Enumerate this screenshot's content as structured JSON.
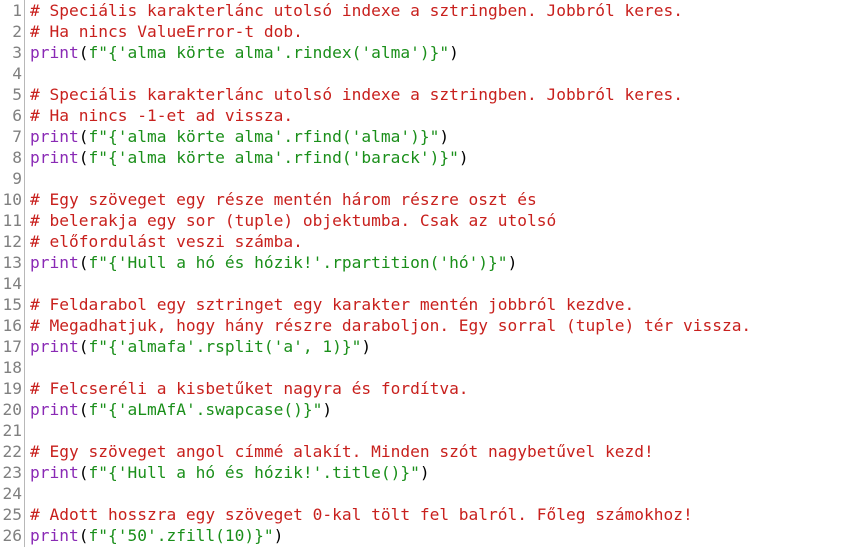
{
  "editor": {
    "lines": [
      {
        "n": "1",
        "tokens": [
          {
            "t": "comment",
            "v": "# Speciális karakterlánc utolsó indexe a sztringben. Jobbról keres."
          }
        ]
      },
      {
        "n": "2",
        "tokens": [
          {
            "t": "comment",
            "v": "# Ha nincs ValueError-t dob."
          }
        ]
      },
      {
        "n": "3",
        "tokens": [
          {
            "t": "builtin",
            "v": "print"
          },
          {
            "t": "plain",
            "v": "("
          },
          {
            "t": "string",
            "v": "f\"{'alma körte alma'.rindex('alma')}\""
          },
          {
            "t": "plain",
            "v": ")"
          }
        ]
      },
      {
        "n": "4",
        "tokens": []
      },
      {
        "n": "5",
        "tokens": [
          {
            "t": "comment",
            "v": "# Speciális karakterlánc utolsó indexe a sztringben. Jobbról keres."
          }
        ]
      },
      {
        "n": "6",
        "tokens": [
          {
            "t": "comment",
            "v": "# Ha nincs -1-et ad vissza."
          }
        ]
      },
      {
        "n": "7",
        "tokens": [
          {
            "t": "builtin",
            "v": "print"
          },
          {
            "t": "plain",
            "v": "("
          },
          {
            "t": "string",
            "v": "f\"{'alma körte alma'.rfind('alma')}\""
          },
          {
            "t": "plain",
            "v": ")"
          }
        ]
      },
      {
        "n": "8",
        "tokens": [
          {
            "t": "builtin",
            "v": "print"
          },
          {
            "t": "plain",
            "v": "("
          },
          {
            "t": "string",
            "v": "f\"{'alma körte alma'.rfind('barack')}\""
          },
          {
            "t": "plain",
            "v": ")"
          }
        ]
      },
      {
        "n": "9",
        "tokens": []
      },
      {
        "n": "10",
        "tokens": [
          {
            "t": "comment",
            "v": "# Egy szöveget egy része mentén három részre oszt és"
          }
        ]
      },
      {
        "n": "11",
        "tokens": [
          {
            "t": "comment",
            "v": "# belerakja egy sor (tuple) objektumba. Csak az utolsó"
          }
        ]
      },
      {
        "n": "12",
        "tokens": [
          {
            "t": "comment",
            "v": "# előfordulást veszi számba."
          }
        ]
      },
      {
        "n": "13",
        "tokens": [
          {
            "t": "builtin",
            "v": "print"
          },
          {
            "t": "plain",
            "v": "("
          },
          {
            "t": "string",
            "v": "f\"{'Hull a hó és hózik!'.rpartition('hó')}\""
          },
          {
            "t": "plain",
            "v": ")"
          }
        ]
      },
      {
        "n": "14",
        "tokens": []
      },
      {
        "n": "15",
        "tokens": [
          {
            "t": "comment",
            "v": "# Feldarabol egy sztringet egy karakter mentén jobbról kezdve."
          }
        ]
      },
      {
        "n": "16",
        "tokens": [
          {
            "t": "comment",
            "v": "# Megadhatjuk, hogy hány részre daraboljon. Egy sorral (tuple) tér vissza."
          }
        ]
      },
      {
        "n": "17",
        "tokens": [
          {
            "t": "builtin",
            "v": "print"
          },
          {
            "t": "plain",
            "v": "("
          },
          {
            "t": "string",
            "v": "f\"{'almafa'.rsplit('a', 1)}\""
          },
          {
            "t": "plain",
            "v": ")"
          }
        ]
      },
      {
        "n": "18",
        "tokens": []
      },
      {
        "n": "19",
        "tokens": [
          {
            "t": "comment",
            "v": "# Felcseréli a kisbetűket nagyra és fordítva."
          }
        ]
      },
      {
        "n": "20",
        "tokens": [
          {
            "t": "builtin",
            "v": "print"
          },
          {
            "t": "plain",
            "v": "("
          },
          {
            "t": "string",
            "v": "f\"{'aLmAfA'.swapcase()}\""
          },
          {
            "t": "plain",
            "v": ")"
          }
        ]
      },
      {
        "n": "21",
        "tokens": []
      },
      {
        "n": "22",
        "tokens": [
          {
            "t": "comment",
            "v": "# Egy szöveget angol címmé alakít. Minden szót nagybetűvel kezd!"
          }
        ]
      },
      {
        "n": "23",
        "tokens": [
          {
            "t": "builtin",
            "v": "print"
          },
          {
            "t": "plain",
            "v": "("
          },
          {
            "t": "string",
            "v": "f\"{'Hull a hó és hózik!'.title()}\""
          },
          {
            "t": "plain",
            "v": ")"
          }
        ]
      },
      {
        "n": "24",
        "tokens": []
      },
      {
        "n": "25",
        "tokens": [
          {
            "t": "comment",
            "v": "# Adott hosszra egy szöveget 0-kal tölt fel balról. Főleg számokhoz!"
          }
        ]
      },
      {
        "n": "26",
        "tokens": [
          {
            "t": "builtin",
            "v": "print"
          },
          {
            "t": "plain",
            "v": "("
          },
          {
            "t": "string",
            "v": "f\"{'50'.zfill(10)}\""
          },
          {
            "t": "plain",
            "v": ")"
          }
        ]
      }
    ]
  },
  "colors": {
    "comment": "#c8201d",
    "builtin": "#8a2ab5",
    "string": "#1a8f1a",
    "plain": "#000000",
    "line_number": "#808080"
  }
}
